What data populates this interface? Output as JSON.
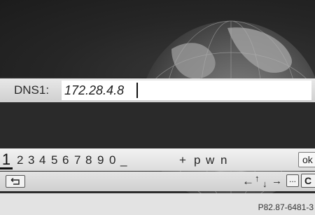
{
  "dns_entry": {
    "label": "DNS1:",
    "value": "172.28.4.8"
  },
  "character_bar": {
    "selected": "1",
    "characters": [
      "2",
      "3",
      "4",
      "5",
      "6",
      "7",
      "8",
      "9",
      "0",
      "_",
      "+",
      "p",
      "w",
      "n"
    ],
    "ok_label": "ok"
  },
  "toolbar": {
    "back_icon": "back-icon",
    "cursor_left": "←",
    "cursor_up": "↑",
    "cursor_down": "↓",
    "cursor_right": "→",
    "ellipsis_label": "...",
    "clear_label": "C"
  },
  "caption": "P82.87-6481-3",
  "colors": {
    "background": "#2c2c2c",
    "input_field": "#ffffff",
    "bar": "#e0e0e0"
  }
}
